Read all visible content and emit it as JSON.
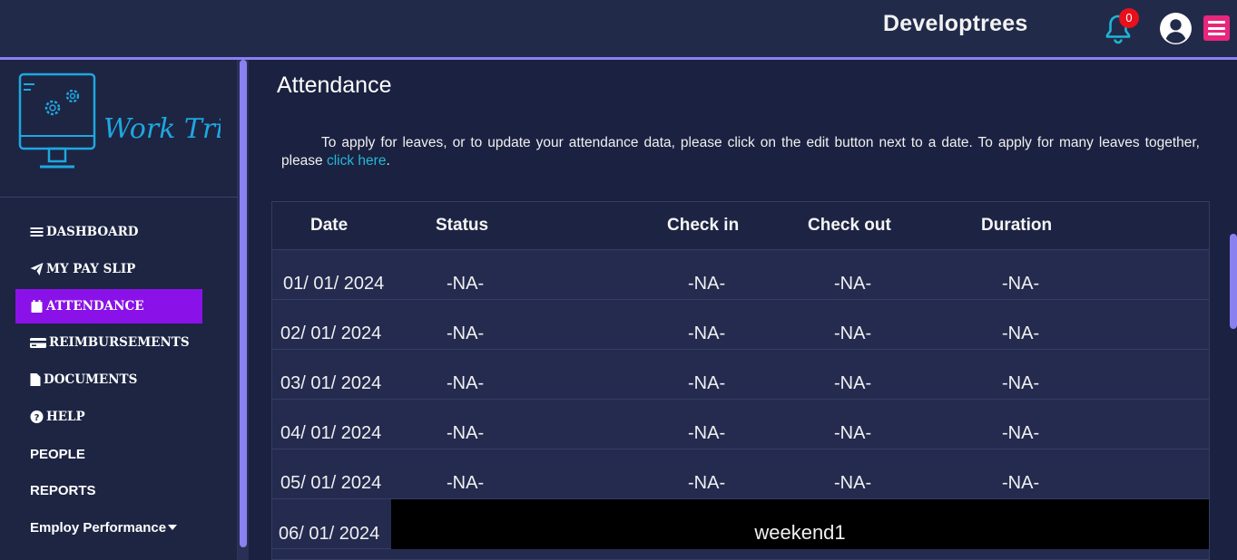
{
  "header": {
    "brand": "Developtrees",
    "notification_count": "0",
    "icons": [
      "bell-icon",
      "user-avatar-icon",
      "hamburger-menu-icon"
    ],
    "accent_color": "#8b80f0",
    "menu_button_color": "#e8267c"
  },
  "sidebar": {
    "logo_text": "Work Tried",
    "items": [
      {
        "label": "DASHBOARD",
        "icon": "bars-icon"
      },
      {
        "label": "MY PAY SLIP",
        "icon": "paper-plane-icon"
      },
      {
        "label": "ATTENDANCE",
        "icon": "calendar-icon",
        "active": true
      },
      {
        "label": "REIMBURSEMENTS",
        "icon": "credit-card-icon"
      },
      {
        "label": "DOCUMENTS",
        "icon": "file-icon"
      },
      {
        "label": "HELP",
        "icon": "question-circle-icon"
      },
      {
        "label": "PEOPLE"
      },
      {
        "label": "REPORTS"
      },
      {
        "label": "Employ Performance",
        "icon": "caret-down-icon"
      }
    ],
    "active_color": "#8a12e8"
  },
  "main": {
    "title": "Attendance",
    "intro_text": "To apply for leaves, or to update your attendance data, please click on the edit button next to a date. To apply for many leaves together, please ",
    "intro_link": "click here",
    "intro_end": ".",
    "table": {
      "headers": [
        "Date",
        "Status",
        "Check in",
        "Check out",
        "Duration"
      ],
      "rows": [
        {
          "date": "01/ 01/ 2024",
          "status": "-NA-",
          "check_in": "-NA-",
          "check_out": "-NA-",
          "duration": "-NA-"
        },
        {
          "date": "02/ 01/ 2024",
          "status": "-NA-",
          "check_in": "-NA-",
          "check_out": "-NA-",
          "duration": "-NA-"
        },
        {
          "date": "03/ 01/ 2024",
          "status": "-NA-",
          "check_in": "-NA-",
          "check_out": "-NA-",
          "duration": "-NA-"
        },
        {
          "date": "04/ 01/ 2024",
          "status": "-NA-",
          "check_in": "-NA-",
          "check_out": "-NA-",
          "duration": "-NA-"
        },
        {
          "date": "05/ 01/ 2024",
          "status": "-NA-",
          "check_in": "-NA-",
          "check_out": "-NA-",
          "duration": "-NA-"
        },
        {
          "date": "06/ 01/ 2024",
          "weekend_label": "weekend1"
        }
      ]
    }
  }
}
